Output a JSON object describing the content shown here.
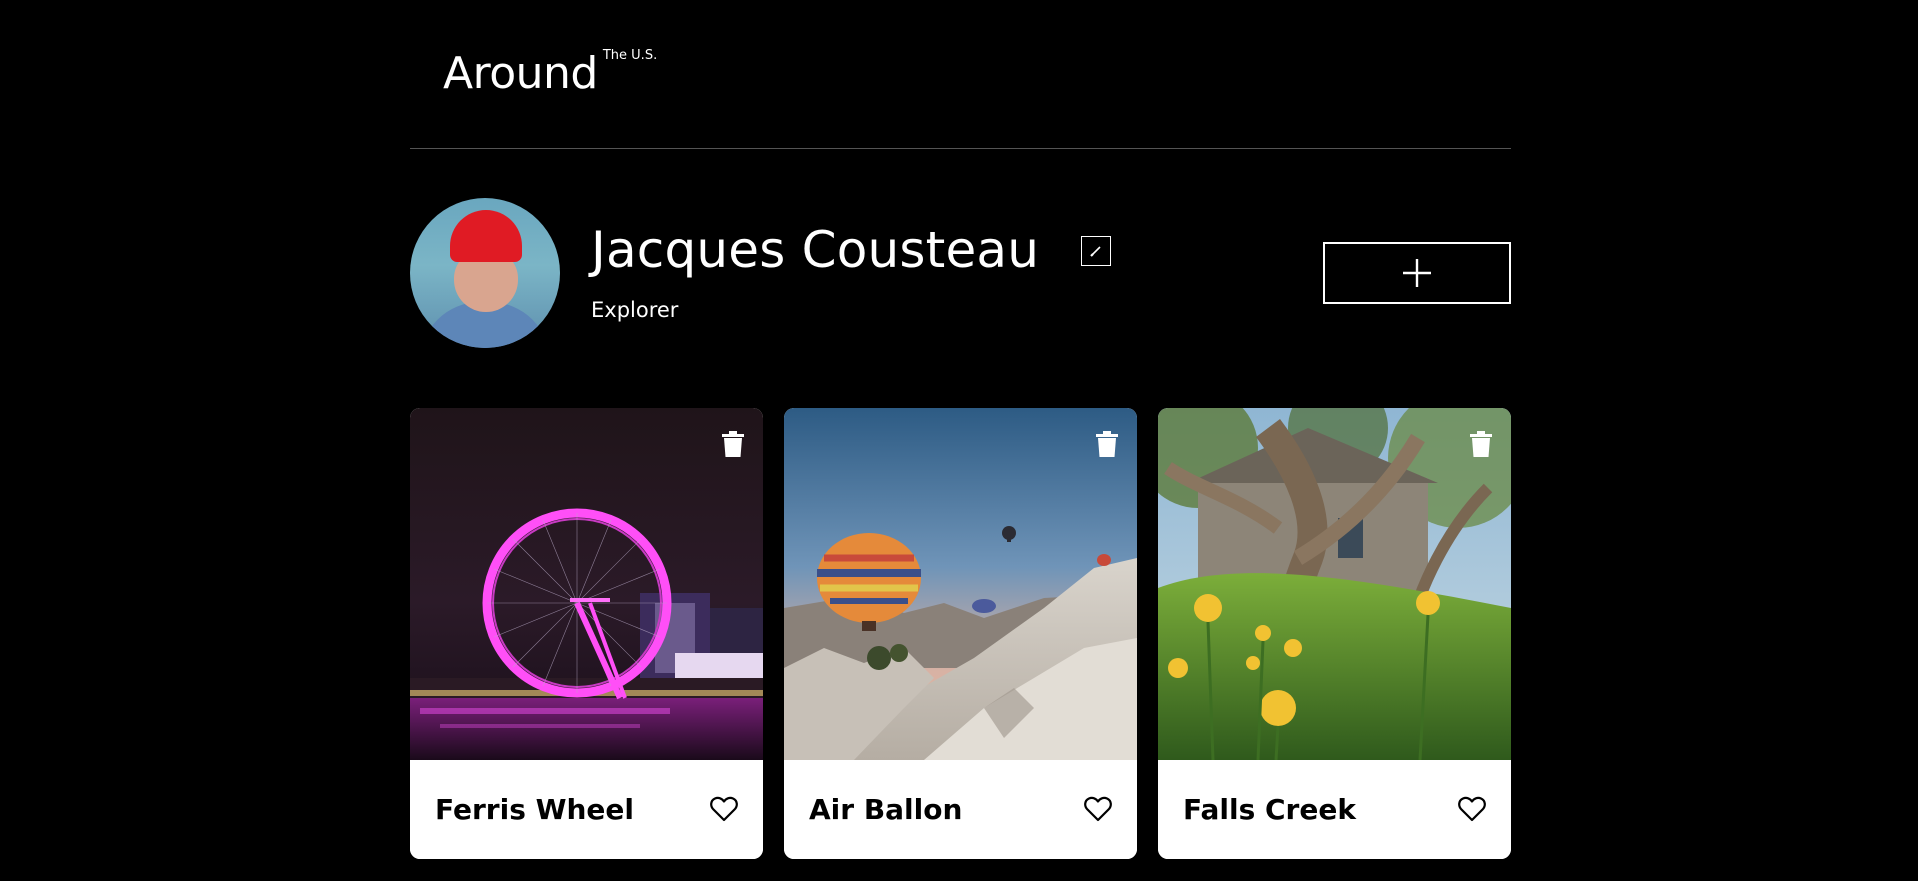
{
  "header": {
    "logo_main": "Around",
    "logo_sup": "The U.S."
  },
  "profile": {
    "name": "Jacques Cousteau",
    "occupation": "Explorer",
    "avatar_icon": "person-avatar",
    "edit_icon": "pencil-icon",
    "add_icon": "plus-icon"
  },
  "cards": [
    {
      "title": "Ferris Wheel",
      "image_icon": "ferris-wheel-photo",
      "delete_icon": "trash-icon",
      "like_icon": "heart-icon"
    },
    {
      "title": "Air Ballon",
      "image_icon": "hot-air-balloon-photo",
      "delete_icon": "trash-icon",
      "like_icon": "heart-icon"
    },
    {
      "title": "Falls Creek",
      "image_icon": "forest-cabin-photo",
      "delete_icon": "trash-icon",
      "like_icon": "heart-icon"
    }
  ],
  "colors": {
    "background": "#000000",
    "text": "#ffffff",
    "card_background": "#ffffff",
    "card_text": "#000000",
    "divider": "#545454"
  }
}
